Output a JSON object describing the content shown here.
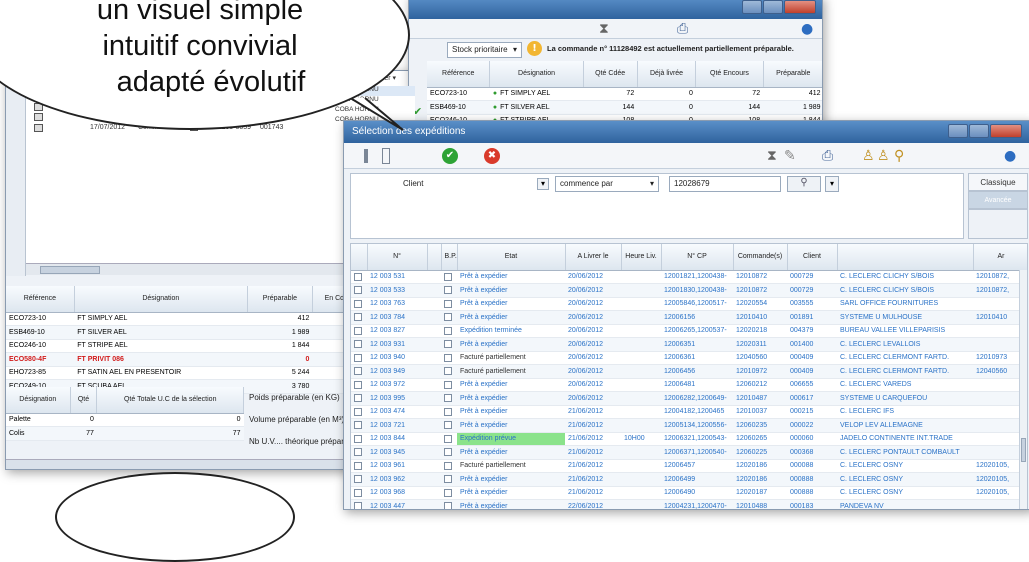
{
  "bubble": {
    "line1": "un visuel simple",
    "line2": "intuitif convivial",
    "line3": "adapté évolutif"
  },
  "win_left": {
    "row_date": "17/07/2012",
    "row_status": "Commande",
    "row_code": "HOR1205-0059",
    "row_num": "001743",
    "tab_label": "Filter ▾",
    "bottom_headers": [
      "Référence",
      "Désignation",
      "Préparable",
      "En Cde",
      "Réappro"
    ],
    "bottom_rows": [
      {
        "ref": "ECO723-10",
        "des": "FT SIMPLY AEL",
        "prep": "412",
        "cde": "0",
        "re": "0",
        "red": false
      },
      {
        "ref": "ESB469-10",
        "des": "FT SILVER AEL",
        "prep": "1 989",
        "cde": "0",
        "re": "0",
        "red": false
      },
      {
        "ref": "ECO246-10",
        "des": "FT STRIPE AEL",
        "prep": "1 844",
        "cde": "0",
        "re": "0",
        "red": false
      },
      {
        "ref": "ECO580-4F",
        "des": "FT PRIVIT 086",
        "prep": "0",
        "cde": "0",
        "re": "0",
        "red": true
      },
      {
        "ref": "EHO723-85",
        "des": "FT SATIN AEL EN PRESENTOIR",
        "prep": "5 244",
        "cde": "0",
        "re": "0",
        "red": false
      },
      {
        "ref": "ECO249-10",
        "des": "FT SCUBA AEL",
        "prep": "3 780",
        "cde": "0",
        "re": "0",
        "red": false
      }
    ],
    "sum_headers": [
      "Désignation",
      "Qté",
      "Qté Totale U.C de la sélection"
    ],
    "sum_rows": [
      {
        "des": "Palette",
        "qte": "0",
        "tot": "0"
      },
      {
        "des": "Colis",
        "qte": "77",
        "tot": "77"
      }
    ],
    "poids": "Poids préparable (en KG)",
    "volume": "Volume préparable (en M³)",
    "nb_uvc": "Nb U.V.... théorique préparable"
  },
  "win_back": {
    "dropdown_value": "Stock prioritaire",
    "message": "La commande n° 11128492 est actuellement partiellement préparable.",
    "headers": [
      "Référence",
      "Désignation",
      "Qté Cdée",
      "Déjà livrée",
      "Qté Encours",
      "Préparable"
    ],
    "rows": [
      {
        "ref": "ECO723-10",
        "des": "FT SIMPLY AEL",
        "cde": "72",
        "deja": "0",
        "enc": "72",
        "prep": "412"
      },
      {
        "ref": "ESB469-10",
        "des": "FT SILVER AEL",
        "cde": "144",
        "deja": "0",
        "enc": "144",
        "prep": "1 989"
      },
      {
        "ref": "ECO246-10",
        "des": "FT STRIPE AEL",
        "cde": "108",
        "deja": "0",
        "enc": "108",
        "prep": "1 844"
      }
    ],
    "side_items": [
      "COBA HORNU",
      "COBA HORNU",
      "COBA HORNU",
      "COBA HORNU"
    ]
  },
  "win_front": {
    "title": "Sélection des expéditions",
    "filter_field": "Client",
    "filter_op": "commence par",
    "filter_value": "12028679",
    "btn_classic": "Classique",
    "btn_advanced": "Avancée",
    "headers": [
      "",
      "N°",
      "",
      "B.P.",
      "Etat",
      "A Livrer le",
      "Heure Liv.",
      "N° CP",
      "Commande(s)",
      "Client",
      "",
      "Ar"
    ],
    "rows": [
      {
        "n": "12 003 531",
        "etat": "Prêt à expédier",
        "date": "20/06/2012",
        "heure": "",
        "cp": "12001821,1200438-",
        "cmd": "12010872",
        "client": "000729",
        "nom": "C. LECLERC CLICHY S/BOIS",
        "ar": "12010872,",
        "green": false
      },
      {
        "n": "12 003 533",
        "etat": "Prêt à expédier",
        "date": "20/06/2012",
        "heure": "",
        "cp": "12001830,1200438-",
        "cmd": "12010872",
        "client": "000729",
        "nom": "C. LECLERC CLICHY S/BOIS",
        "ar": "12010872,",
        "green": false
      },
      {
        "n": "12 003 763",
        "etat": "Prêt à expédier",
        "date": "20/06/2012",
        "heure": "",
        "cp": "12005846,1200517-",
        "cmd": "12020554",
        "client": "003555",
        "nom": "SARL OFFICE FOURNITURES",
        "ar": "",
        "green": false
      },
      {
        "n": "12 003 784",
        "etat": "Prêt à expédier",
        "date": "20/06/2012",
        "heure": "",
        "cp": "12006156",
        "cmd": "12010410",
        "client": "001891",
        "nom": "SYSTEME U MULHOUSE",
        "ar": "12010410",
        "green": false
      },
      {
        "n": "12 003 827",
        "etat": "Expédition terminée",
        "date": "20/06/2012",
        "heure": "",
        "cp": "12006265,1200537-",
        "cmd": "12020218",
        "client": "004379",
        "nom": "BUREAU VALLEE VILLEPARISIS",
        "ar": "",
        "green": false
      },
      {
        "n": "12 003 931",
        "etat": "Prêt à expédier",
        "date": "20/06/2012",
        "heure": "",
        "cp": "12006351",
        "cmd": "12020311",
        "client": "001400",
        "nom": "C. LECLERC LEVALLOIS",
        "ar": "",
        "green": false
      },
      {
        "n": "12 003 940",
        "etat": "Facturé partiellement",
        "date": "20/06/2012",
        "heure": "",
        "cp": "12006361",
        "cmd": "12040560",
        "client": "000409",
        "nom": "C. LECLERC CLERMONT FARTD.",
        "ar": "12010973",
        "green": false
      },
      {
        "n": "12 003 949",
        "etat": "Facturé partiellement",
        "date": "20/06/2012",
        "heure": "",
        "cp": "12006456",
        "cmd": "12010972",
        "client": "000409",
        "nom": "C. LECLERC CLERMONT FARTD.",
        "ar": "12040560",
        "green": false
      },
      {
        "n": "12 003 972",
        "etat": "Prêt à expédier",
        "date": "20/06/2012",
        "heure": "",
        "cp": "12006481",
        "cmd": "12060212",
        "client": "006655",
        "nom": "C. LECLERC VAREDS",
        "ar": "",
        "green": false
      },
      {
        "n": "12 003 995",
        "etat": "Prêt à expédier",
        "date": "20/06/2012",
        "heure": "",
        "cp": "12006282,1200649-",
        "cmd": "12010487",
        "client": "000617",
        "nom": "SYSTEME U CARQUEFOU",
        "ar": "",
        "green": false
      },
      {
        "n": "12 003 474",
        "etat": "Prêt à expédier",
        "date": "21/06/2012",
        "heure": "",
        "cp": "12004182,1200465",
        "cmd": "12010037",
        "client": "000215",
        "nom": "C. LECLERC IFS",
        "ar": "",
        "green": false
      },
      {
        "n": "12 003 721",
        "etat": "Prêt à expédier",
        "date": "21/06/2012",
        "heure": "",
        "cp": "12005134,1200556-",
        "cmd": "12060235",
        "client": "000022",
        "nom": "VELOP LEV ALLEMAGNE",
        "ar": "",
        "green": false
      },
      {
        "n": "12 003 844",
        "etat": "Expédition prévue",
        "date": "21/06/2012",
        "heure": "10H00",
        "cp": "12006321,1200543-",
        "cmd": "12060265",
        "client": "000060",
        "nom": "JADELO CONTINENTE INT.TRADE",
        "ar": "",
        "green": true
      },
      {
        "n": "12 003 945",
        "etat": "Prêt à expédier",
        "date": "21/06/2012",
        "heure": "",
        "cp": "12006371,1200540-",
        "cmd": "12060225",
        "client": "000368",
        "nom": "C. LECLERC PONTAULT COMBAULT",
        "ar": "",
        "green": false
      },
      {
        "n": "12 003 961",
        "etat": "Facturé partiellement",
        "date": "21/06/2012",
        "heure": "",
        "cp": "12006457",
        "cmd": "12020186",
        "client": "000088",
        "nom": "C. LECLERC OSNY",
        "ar": "12020105,",
        "green": false
      },
      {
        "n": "12 003 962",
        "etat": "Prêt à expédier",
        "date": "21/06/2012",
        "heure": "",
        "cp": "12006499",
        "cmd": "12020186",
        "client": "000888",
        "nom": "C. LECLERC OSNY",
        "ar": "12020105,",
        "green": false
      },
      {
        "n": "12 003 968",
        "etat": "Prêt à expédier",
        "date": "21/06/2012",
        "heure": "",
        "cp": "12006490",
        "cmd": "12020187",
        "client": "000888",
        "nom": "C. LECLERC OSNY",
        "ar": "12020105,",
        "green": false
      },
      {
        "n": "12 003 447",
        "etat": "Prêt à expédier",
        "date": "22/06/2012",
        "heure": "",
        "cp": "12004231,1200470-",
        "cmd": "12010488",
        "client": "000183",
        "nom": "PANDEVA NV",
        "ar": "",
        "green": false
      }
    ]
  }
}
